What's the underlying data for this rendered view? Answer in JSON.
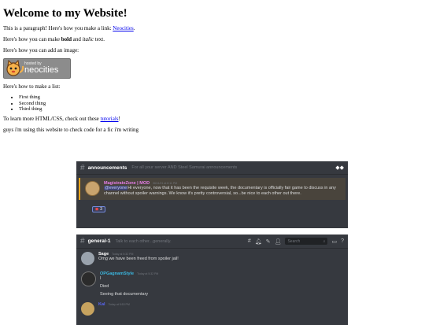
{
  "heading": "Welcome to my Website!",
  "para1": {
    "prefix": "This is a paragraph! Here's how you make a link: ",
    "link": "Neocities",
    "suffix": "."
  },
  "para2": {
    "a": "Here's how you can make ",
    "bold": "bold",
    "b": " and ",
    "italic": "italic",
    "c": " text."
  },
  "para3": "Here's how you can add an image:",
  "badge": {
    "small": "hosted by",
    "big": "neocities"
  },
  "para4": "Here's how to make a list:",
  "list": [
    "First thing",
    "Second thing",
    "Third thing"
  ],
  "para5": {
    "prefix": "To learn more HTML/CSS, check out these ",
    "link": "tutorials",
    "suffix": "!"
  },
  "para6": "guys i'm using this website to check code for a fic i'm writing",
  "panel1": {
    "channel": "announcements",
    "topic": "For all your server AND Steel Samurai announcements",
    "message": {
      "user": "MagistrateZone | MOD",
      "time": "06/11/21 at 8:11 PM",
      "mention": "@everyone",
      "text": "Hi everyone, now that it has been the requisite week, the documentary is officially fair game to discuss in any channel without spoiler warnings. We know it's pretty controversial, so...be nice to each other out there.",
      "reaction_count": "3"
    }
  },
  "panel2": {
    "channel": "general-1",
    "topic": "Talk to each other...generally.",
    "search_placeholder": "Search",
    "messages": [
      {
        "user": "Sage",
        "time": "Today at 5:32 PM",
        "lines": [
          "Omg we have been freed from spoiler jail!"
        ]
      },
      {
        "user": "OPGagnamStyle",
        "time": "Today at 5:32 PM",
        "lines": [
          "I",
          "Died",
          "Seeing that documentary"
        ]
      },
      {
        "user": "Kal",
        "time": "Today at 5:53 PM",
        "lines": []
      }
    ]
  },
  "colors": {
    "link": "#0000ee",
    "discord_bg": "#36393f",
    "mod_name": "#e67ee8",
    "sage_name": "#ffffff",
    "op_name": "#3ab7e0",
    "kal_name": "#5865f2"
  }
}
